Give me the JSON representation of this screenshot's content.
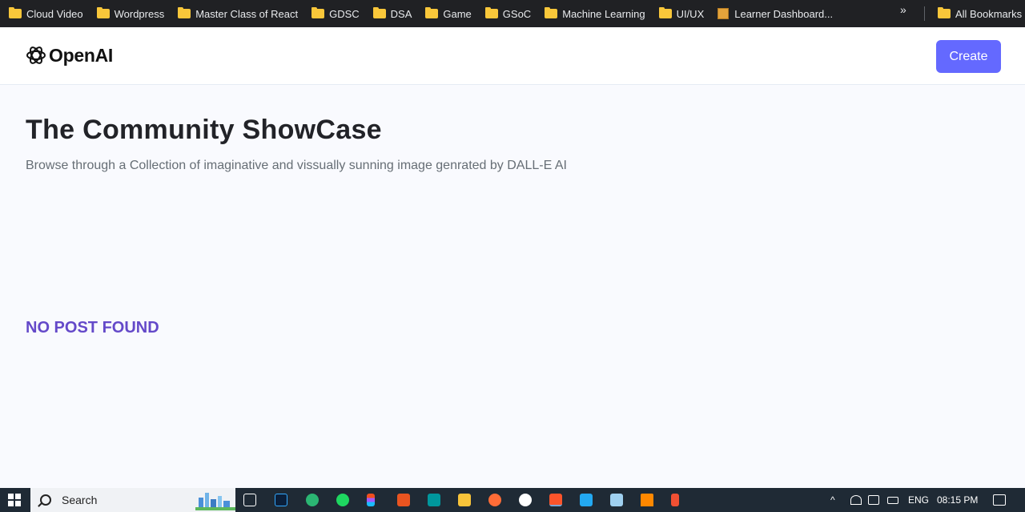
{
  "bookmarks": [
    {
      "label": "Cloud Video",
      "icon": "folder-icon"
    },
    {
      "label": "Wordpress",
      "icon": "folder-icon"
    },
    {
      "label": "Master Class of React",
      "icon": "folder-icon"
    },
    {
      "label": "GDSC",
      "icon": "folder-icon"
    },
    {
      "label": "DSA",
      "icon": "folder-icon"
    },
    {
      "label": "Game",
      "icon": "folder-icon"
    },
    {
      "label": "GSoC",
      "icon": "folder-icon"
    },
    {
      "label": "Machine Learning",
      "icon": "folder-icon"
    },
    {
      "label": "UI/UX",
      "icon": "folder-icon"
    },
    {
      "label": "Learner Dashboard...",
      "icon": "box-icon"
    }
  ],
  "bookmarks_more": "»",
  "all_bookmarks": "All Bookmarks",
  "header": {
    "logo_text": "OpenAI",
    "create_label": "Create",
    "accent": "#6469ff"
  },
  "main": {
    "title": "The Community ShowCase",
    "subtitle": "Browse through a Collection of imaginative and vissually sunning image genrated by DALL-E AI",
    "empty_message": "NO POST FOUND",
    "empty_color": "#6449c9"
  },
  "taskbar": {
    "search_placeholder": "Search",
    "language": "ENG",
    "time": "08:15 PM"
  }
}
